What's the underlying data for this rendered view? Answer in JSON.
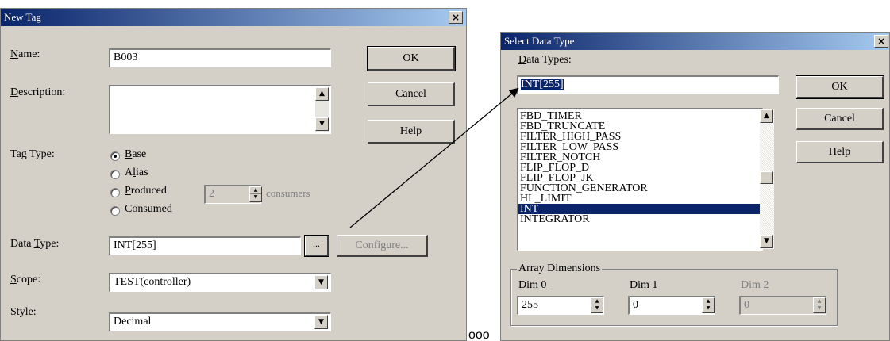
{
  "new_tag": {
    "title": "New Tag",
    "close": "×",
    "name_label_u": "N",
    "name_label_rest": "ame:",
    "name_value": "B003",
    "desc_label_u": "D",
    "desc_label_rest": "escription:",
    "tag_type_label": "Tag Type:",
    "radio_base_u": "B",
    "radio_base_rest": "ase",
    "radio_alias_pre": "A",
    "radio_alias_u": "l",
    "radio_alias_rest": "ias",
    "radio_produced_u": "P",
    "radio_produced_rest": "roduced",
    "radio_consumed_pre": "C",
    "radio_consumed_u": "o",
    "radio_consumed_rest": "nsumed",
    "consumers_value": "2",
    "consumers_label": "consumers",
    "data_type_label_pre": "Data ",
    "data_type_label_u": "T",
    "data_type_label_rest": "ype:",
    "data_type_value": "INT[255]",
    "configure_label": "Configure...",
    "scope_label_u": "S",
    "scope_label_rest": "cope:",
    "scope_value": "TEST(controller)",
    "style_label_pre": "St",
    "style_label_u": "y",
    "style_label_rest": "le:",
    "style_value": "Decimal",
    "ok": "OK",
    "cancel": "Cancel",
    "help": "Help",
    "ellipsis": "..."
  },
  "select_data_type": {
    "title": "Select Data Type",
    "close": "×",
    "data_types_label_u": "D",
    "data_types_label_rest": "ata Types:",
    "data_types_value": "INT[255]",
    "list_items": [
      "FBD_TIMER",
      "FBD_TRUNCATE",
      "FILTER_HIGH_PASS",
      "FILTER_LOW_PASS",
      "FILTER_NOTCH",
      "FLIP_FLOP_D",
      "FLIP_FLOP_JK",
      "FUNCTION_GENERATOR",
      "HL_LIMIT",
      "INT",
      "INTEGRATOR"
    ],
    "selected_item": "INT",
    "array_dimensions_label": "Array Dimensions",
    "dim0_label_pre": "Dim ",
    "dim0_label_u": "0",
    "dim0_value": "255",
    "dim1_label_pre": "Dim ",
    "dim1_label_u": "1",
    "dim1_value": "0",
    "dim2_label_pre": "Dim ",
    "dim2_label_u": "2",
    "dim2_value": "0",
    "ok": "OK",
    "cancel": "Cancel",
    "help": "Help"
  },
  "stray_text": "ooo"
}
